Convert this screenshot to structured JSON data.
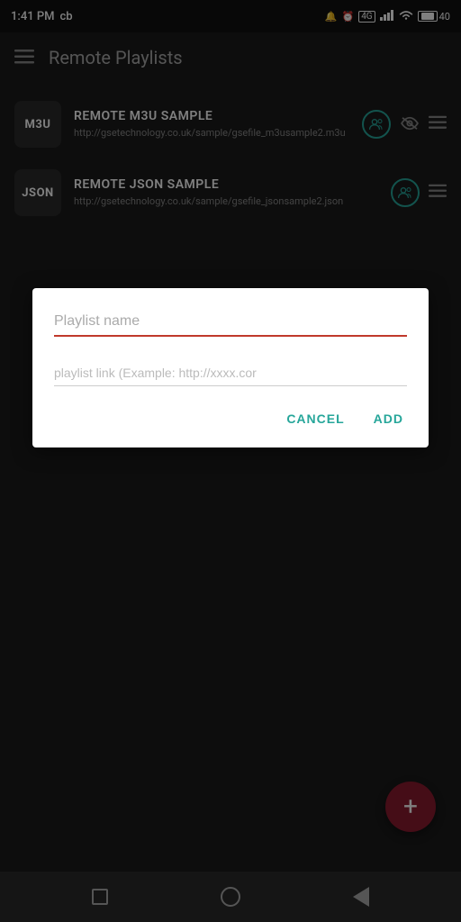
{
  "status_bar": {
    "time": "1:41 PM",
    "carrier": "cb",
    "battery": "40"
  },
  "app_bar": {
    "title": "Remote Playlists"
  },
  "playlists": [
    {
      "id": "m3u",
      "badge": "M3U",
      "name": "REMOTE M3U SAMPLE",
      "url": "http://gsetechnology.co.uk/sample/gsefile_m3usample2.m3u",
      "has_eye": true
    },
    {
      "id": "json",
      "badge": "JSON",
      "name": "REMOTE JSON SAMPLE",
      "url": "http://gsetechnology.co.uk/sample/gsefile_jsonsample2.json",
      "has_eye": false
    }
  ],
  "dialog": {
    "name_placeholder": "Playlist name",
    "link_placeholder": "playlist link (Example: http://xxxx.cor",
    "cancel_label": "CANCEL",
    "add_label": "ADD"
  },
  "fab": {
    "icon": "+"
  }
}
